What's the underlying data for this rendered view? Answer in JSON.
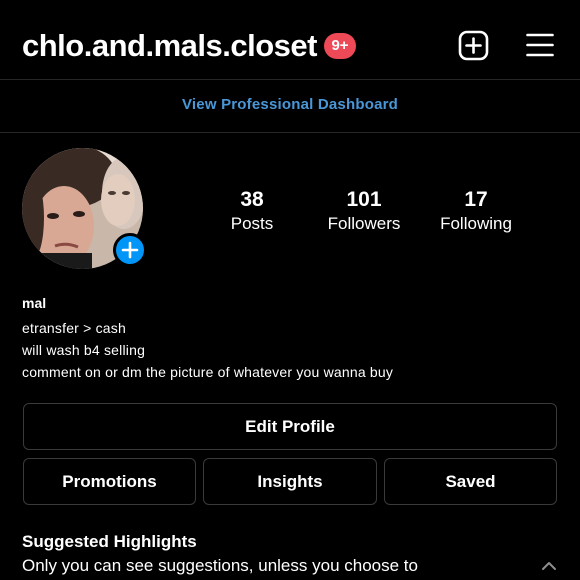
{
  "header": {
    "username": "chlo.and.mals.closet",
    "notification_badge": "9+",
    "add_icon": "plus-square-icon",
    "menu_icon": "hamburger-menu-icon"
  },
  "dashboard": {
    "link_label": "View Professional Dashboard"
  },
  "profile": {
    "avatar_icon": "profile-photo",
    "add_story_icon": "plus-icon",
    "stats": [
      {
        "value": "38",
        "label": "Posts"
      },
      {
        "value": "101",
        "label": "Followers"
      },
      {
        "value": "17",
        "label": "Following"
      }
    ],
    "name": "mal",
    "bio": [
      "etransfer > cash",
      "will wash b4 selling",
      "comment on or dm the picture of whatever you wanna buy"
    ]
  },
  "buttons": {
    "edit_profile": "Edit Profile",
    "promotions": "Promotions",
    "insights": "Insights",
    "saved": "Saved"
  },
  "highlights": {
    "title": "Suggested Highlights",
    "description": "Only you can see suggestions, unless you choose to",
    "collapse_icon": "chevron-up-icon"
  },
  "colors": {
    "background": "#000000",
    "badge": "#ed4956",
    "link": "#4a97d8",
    "accent": "#0095f6",
    "border": "#3a3a3a"
  }
}
